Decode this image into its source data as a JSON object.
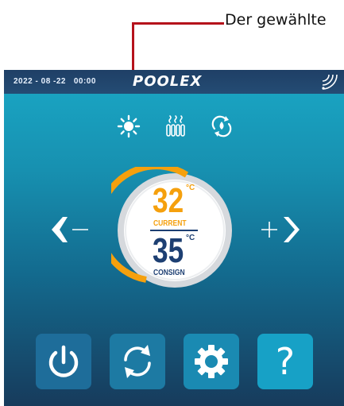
{
  "annotation": {
    "text": "Der gewählte"
  },
  "status_bar": {
    "date": "2022 - 08 -22",
    "time": "00:00",
    "brand": "POOLEX"
  },
  "icons": {
    "wifi": "wifi-icon",
    "modes": [
      "sun-icon",
      "radiator-heat-icon",
      "auto-cycle-icon"
    ],
    "left": "chevron-left-minus-icon",
    "right": "plus-chevron-right-icon"
  },
  "gauge": {
    "current_temp": "32",
    "current_unit": "°C",
    "current_label": "CURRENT",
    "consign_temp": "35",
    "consign_unit": "°C",
    "consign_label": "CONSIGN"
  },
  "actions": [
    "power-icon",
    "refresh-icon",
    "gear-icon",
    "help-icon"
  ],
  "help_glyph": "?",
  "colors": {
    "accent_orange": "#f5a00d",
    "navy": "#1d3f72",
    "callout_red": "#b5121b"
  }
}
